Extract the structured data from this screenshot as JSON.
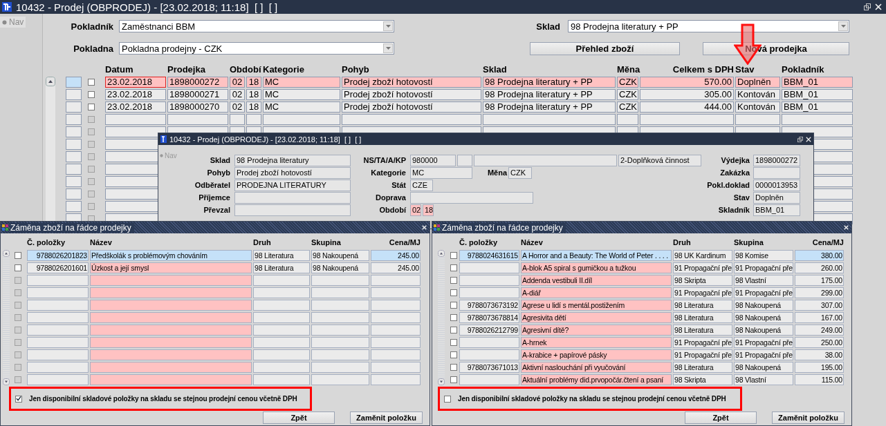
{
  "window": {
    "title": "10432 - Prodej (OBPRODEJ) - [23.02.2018; 11:18]  [ ]  [ ]",
    "nav": "Nav"
  },
  "filters": [
    {
      "label": "Pokladník",
      "value": "Zaměstnanci BBM"
    },
    {
      "label": "Sklad",
      "value": "98 Prodejna literatury + PP"
    },
    {
      "label": "Pokladna",
      "value": "Pokladna prodejny - CZK"
    }
  ],
  "buttons": [
    "Přehled zboží",
    "Nová prodejka"
  ],
  "table": {
    "columns": [
      "Datum",
      "Prodejka",
      "Období",
      "Kategorie",
      "Pohyb",
      "Sklad",
      "Měna",
      "Celkem s DPH",
      "Stav",
      "Pokladník"
    ],
    "rows": [
      {
        "selected": true,
        "checked": false,
        "cells": [
          "23.02.2018",
          "1898000272",
          [
            "02",
            "18"
          ],
          "MC",
          "Prodej zboží hotovostí",
          "98 Prodejna literatury + PP",
          "CZK",
          "570.00",
          "Doplněn",
          "BBM_01"
        ]
      },
      {
        "selected": false,
        "checked": false,
        "cells": [
          "23.02.2018",
          "1898000271",
          [
            "02",
            "18"
          ],
          "MC",
          "Prodej zboží hotovostí",
          "98 Prodejna literatury + PP",
          "CZK",
          "305.00",
          "Kontován",
          "BBM_01"
        ]
      },
      {
        "selected": false,
        "checked": false,
        "cells": [
          "23.02.2018",
          "1898000270",
          [
            "02",
            "18"
          ],
          "MC",
          "Prodej zboží hotovostí",
          "98 Prodejna literatury + PP",
          "CZK",
          "444.00",
          "Kontován",
          "BBM_01"
        ]
      }
    ]
  },
  "detail": {
    "title": "10432 - Prodej (OBPRODEJ) - [23.02.2018; 11:18]  [ ]  [ ]",
    "nav": "Nav",
    "rows": [
      {
        "left": {
          "label": "Sklad",
          "value": "98 Prodejna literatury"
        },
        "middle": {
          "kind": "code",
          "label": "NS/TA/A/KP",
          "values": [
            "980000",
            "2-Doplňková činnost"
          ]
        },
        "right": {
          "label": "Výdejka",
          "value": "1898000272"
        }
      },
      {
        "left": {
          "label": "Pohyb",
          "value": "Prodej zboží hotovostí"
        },
        "middle": {
          "kind": "pair",
          "label": "Kategorie",
          "value": "MC",
          "label2": "Měna",
          "value2": "CZK"
        },
        "right": {
          "label": "Zakázka"
        }
      },
      {
        "left": {
          "label": "Odběratel",
          "value": "PRODEJNA LITERATURY"
        },
        "middle": {
          "kind": "short",
          "label": "Stát",
          "value": "CZE"
        },
        "right": {
          "label": "Pokl.doklad",
          "value": "0000013953"
        }
      },
      {
        "left": {
          "label": "Příjemce"
        },
        "middle": {
          "kind": "wide",
          "label": "Doprava"
        },
        "right": {
          "label": "Stav",
          "value": "Doplněn"
        }
      },
      {
        "left": {
          "label": "Převzal"
        },
        "middle": {
          "kind": "period",
          "label": "Období",
          "values": [
            "02",
            "18"
          ]
        },
        "right": {
          "label": "Skladník",
          "value": "BBM_01"
        }
      }
    ]
  },
  "dialogs": [
    {
      "title": "Záměna zboží na řádce prodejky",
      "columns": [
        "Č. položky",
        "Název",
        "Druh",
        "Skupina",
        "Cena/MJ"
      ],
      "rows": [
        {
          "selected": true,
          "checked": false,
          "number": "9788026201823",
          "name": "Předškolák s problémovým chováním",
          "type": "98 Literatura",
          "group": "98 Nakoupená",
          "price": "245.00"
        },
        {
          "selected": false,
          "checked": false,
          "number": "9788026201601",
          "name": "Úzkost a její smysl",
          "type": "98 Literatura",
          "group": "98 Nakoupená",
          "price": "245.00"
        }
      ],
      "filter": {
        "label": "Jen disponibilní skladové položky na skladu se stejnou prodejní cenou včetně DPH",
        "checked": true
      },
      "buttons": [
        "Zpět",
        "Zaměnit položku"
      ]
    },
    {
      "title": "Záměna zboží na řádce prodejky",
      "columns": [
        "Č. položky",
        "Název",
        "Druh",
        "Skupina",
        "Cena/MJ"
      ],
      "rows": [
        {
          "selected": true,
          "checked": false,
          "number": "9788024631615",
          "name": "A Horror and a Beauty: The World of Peter . . . .",
          "type": "98 UK Kardinum",
          "group": "98 Komise",
          "price": "380.00"
        },
        {
          "selected": false,
          "checked": false,
          "name": "A-blok A5 spiral s gumičkou a tužkou",
          "type": "91 Propagační pře",
          "group": "91 Propagační pře",
          "price": "260.00"
        },
        {
          "selected": false,
          "checked": false,
          "name": "Addenda vestibuli II.díl",
          "type": "98 Skripta",
          "group": "98 Vlastní",
          "price": "175.00"
        },
        {
          "selected": false,
          "checked": false,
          "name": "A-diář",
          "type": "91 Propagační pře",
          "group": "91 Propagační pře",
          "price": "299.00"
        },
        {
          "selected": false,
          "checked": false,
          "number": "9788073673192",
          "name": "Agrese u lidí s mentál.postižením",
          "type": "98 Literatura",
          "group": "98 Nakoupená",
          "price": "307.00"
        },
        {
          "selected": false,
          "checked": false,
          "number": "9788073678814",
          "name": "Agresivita dětí",
          "type": "98 Literatura",
          "group": "98 Nakoupená",
          "price": "167.00"
        },
        {
          "selected": false,
          "checked": false,
          "number": "9788026212799",
          "name": "Agresivní dítě?",
          "type": "98 Literatura",
          "group": "98 Nakoupená",
          "price": "249.00"
        },
        {
          "selected": false,
          "checked": false,
          "name": "A-hrnek",
          "type": "91 Propagační pře",
          "group": "91 Propagační pře",
          "price": "250.00"
        },
        {
          "selected": false,
          "checked": false,
          "name": "A-krabice + papírové pásky",
          "type": "91 Propagační pře",
          "group": "91 Propagační pře",
          "price": "38.00"
        },
        {
          "selected": false,
          "checked": false,
          "number": "9788073671013",
          "name": "Aktivní naslouchání při vyučování",
          "type": "98 Literatura",
          "group": "98 Nakoupená",
          "price": "195.00"
        },
        {
          "selected": false,
          "checked": false,
          "name": "Aktuální problémy did.prvopočár.čtení a psaní",
          "type": "98 Skripta",
          "group": "98 Vlastní",
          "price": "115.00"
        }
      ],
      "filter": {
        "label": "Jen disponibilní skladové položky na skladu se stejnou prodejní cenou včetně DPH",
        "checked": false
      },
      "buttons": [
        "Zpět",
        "Zaměnit položku"
      ]
    }
  ]
}
